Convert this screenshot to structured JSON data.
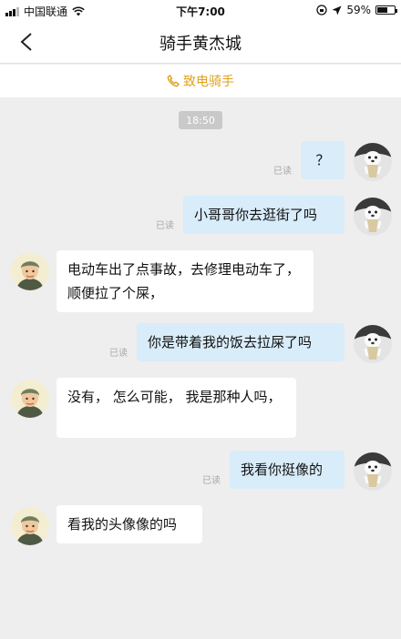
{
  "status_bar": {
    "carrier": "中国联通",
    "time": "下午7:00",
    "battery_percent": "59%",
    "battery_level": 0.59
  },
  "header": {
    "title": "骑手黄杰城",
    "call_icon": "phone-icon",
    "call_label": "致电骑手"
  },
  "chat": {
    "timestamp": "18:50",
    "messages": [
      {
        "side": "out",
        "text": "？",
        "read": "已读"
      },
      {
        "side": "out",
        "text": "小哥哥你去逛街了吗",
        "read": "已读"
      },
      {
        "side": "in",
        "text": "电动车出了点事故，去修理电动车了，顺便拉了个屎，",
        "read": ""
      },
      {
        "side": "out",
        "text": "你是带着我的饭去拉屎了吗",
        "read": "已读"
      },
      {
        "side": "in",
        "text": "没有，  怎么可能，  我是那种人吗，",
        "read": ""
      },
      {
        "side": "out",
        "text": "我看你挺像的",
        "read": "已读"
      },
      {
        "side": "in",
        "text": "看我的头像像的吗",
        "read": ""
      }
    ]
  },
  "colors": {
    "accent": "#e0a11b",
    "out_bubble": "#d8ecfa",
    "in_bubble": "#ffffff",
    "background": "#eeeeee"
  }
}
